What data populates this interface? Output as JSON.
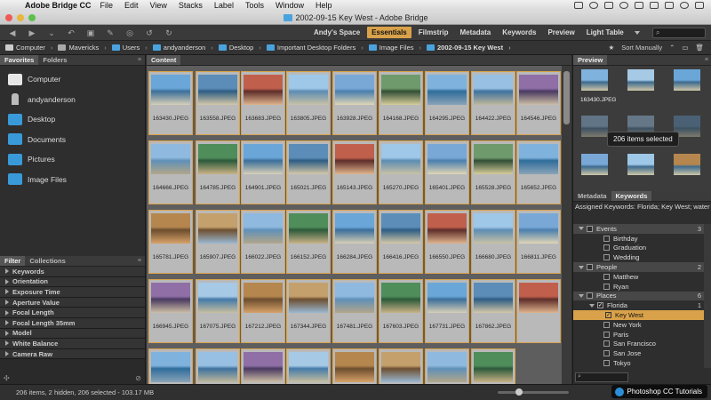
{
  "menubar": {
    "apple": "",
    "app_name": "Adobe Bridge CC",
    "items": [
      "File",
      "Edit",
      "View",
      "Stacks",
      "Label",
      "Tools",
      "Window",
      "Help"
    ],
    "clock": "Fri 12:05 PM"
  },
  "window": {
    "title": "2002-09-15 Key West - Adobe Bridge"
  },
  "workspaces": [
    "Andy's Space",
    "Essentials",
    "Filmstrip",
    "Metadata",
    "Keywords",
    "Preview",
    "Light Table"
  ],
  "active_workspace": "Essentials",
  "search_placeholder": "",
  "path": [
    "Computer",
    "Mavericks",
    "Users",
    "andyanderson",
    "Desktop",
    "Important Desktop Folders",
    "Image Files",
    "2002-09-15 Key West"
  ],
  "sort": "Sort Manually",
  "favorites_tabs": [
    "Favorites",
    "Folders"
  ],
  "favorites": [
    "Computer",
    "andyanderson",
    "Desktop",
    "Documents",
    "Pictures",
    "Image Files"
  ],
  "filter_tabs": [
    "Filter",
    "Collections"
  ],
  "filters": [
    "Keywords",
    "Orientation",
    "Exposure Time",
    "Aperture Value",
    "Focal Length",
    "Focal Length 35mm",
    "Model",
    "White Balance",
    "Camera Raw"
  ],
  "content_tab": "Content",
  "thumbnails": [
    "163430.JPEG",
    "163558.JPEG",
    "163683.JPEG",
    "163805.JPEG",
    "163928.JPEG",
    "164168.JPEG",
    "164295.JPEG",
    "164422.JPEG",
    "164546.JPEG",
    "164666.JPEG",
    "164785.JPEG",
    "164901.JPEG",
    "165021.JPEG",
    "165143.JPEG",
    "165270.JPEG",
    "165401.JPEG",
    "165528.JPEG",
    "165652.JPEG",
    "165781.JPEG",
    "165907.JPEG",
    "166022.JPEG",
    "166152.JPEG",
    "166284.JPEG",
    "166416.JPEG",
    "166550.JPEG",
    "166680.JPEG",
    "166811.JPEG",
    "166945.JPEG",
    "167075.JPEG",
    "167212.JPEG",
    "167344.JPEG",
    "167481.JPEG",
    "167603.JPEG",
    "167731.JPEG",
    "167862.JPEG",
    "",
    "",
    "",
    "",
    "",
    "",
    "",
    "",
    ""
  ],
  "preview": {
    "tab": "Preview",
    "labels": [
      "163430.JPEG",
      "206 items selected"
    ],
    "tooltip": "206 items selected"
  },
  "keywords_panel": {
    "tabs": [
      "Metadata",
      "Keywords"
    ],
    "assigned": "Assigned Keywords: Florida; Key West; water",
    "rows": [
      {
        "label": "Events",
        "count": "3",
        "type": "cat"
      },
      {
        "label": "Birthday",
        "count": "",
        "type": "sub"
      },
      {
        "label": "Graduation",
        "count": "",
        "type": "sub"
      },
      {
        "label": "Wedding",
        "count": "",
        "type": "sub"
      },
      {
        "label": "People",
        "count": "2",
        "type": "cat"
      },
      {
        "label": "Matthew",
        "count": "",
        "type": "sub"
      },
      {
        "label": "Ryan",
        "count": "",
        "type": "sub"
      },
      {
        "label": "Places",
        "count": "6",
        "type": "cat"
      },
      {
        "label": "Florida",
        "count": "1",
        "type": "sub2"
      },
      {
        "label": "Key West",
        "count": "",
        "type": "sel"
      },
      {
        "label": "New York",
        "count": "",
        "type": "sub"
      },
      {
        "label": "Paris",
        "count": "",
        "type": "sub"
      },
      {
        "label": "San Francisco",
        "count": "",
        "type": "sub"
      },
      {
        "label": "San Jose",
        "count": "",
        "type": "sub"
      },
      {
        "label": "Tokyo",
        "count": "",
        "type": "sub"
      }
    ]
  },
  "status": "206 items, 2 hidden, 206 selected - 103.17 MB",
  "watermark": "Photoshop CC Tutorials",
  "colors": {
    "accent": "#d9a24a",
    "folder": "#4aa3df"
  }
}
